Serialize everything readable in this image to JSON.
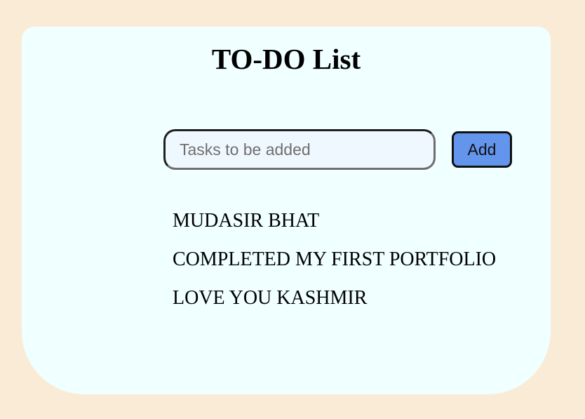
{
  "app": {
    "title": "TO-DO List"
  },
  "input": {
    "placeholder": "Tasks to be added",
    "value": ""
  },
  "add_button": {
    "label": "Add"
  },
  "tasks": [
    {
      "text": "MUDASIR BHAT"
    },
    {
      "text": "COMPLETED MY FIRST PORTFOLIO"
    },
    {
      "text": "LOVE YOU KASHMIR"
    }
  ],
  "colors": {
    "page_background": "#FAEBD7",
    "card_background": "#F0FFFF",
    "input_background": "#F0F8FF",
    "button_background": "#6495ED"
  }
}
